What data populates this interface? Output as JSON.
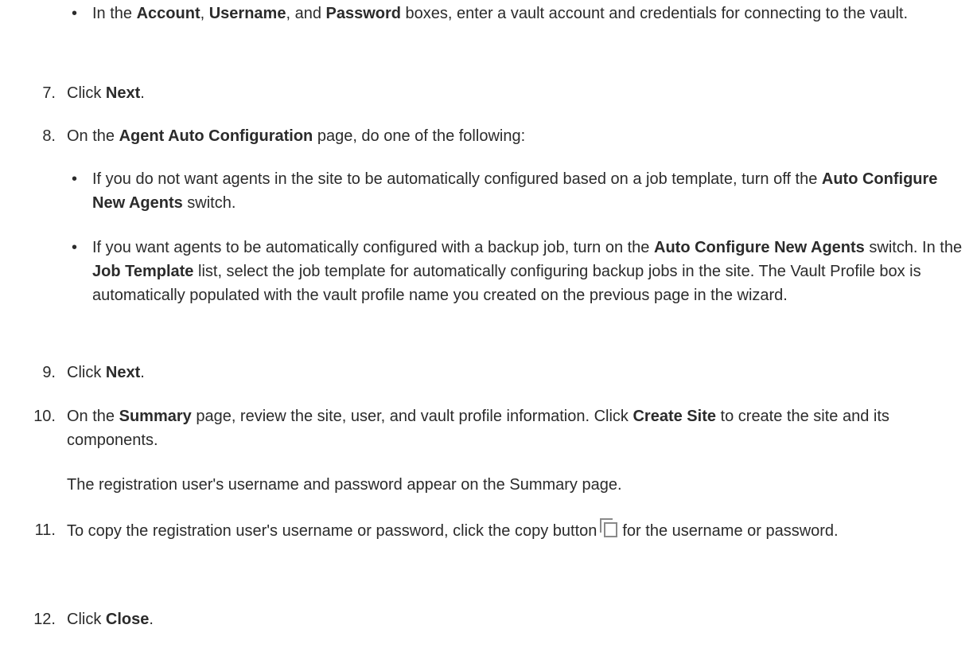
{
  "bullet_char": "•",
  "steps": {
    "s6_bullet": {
      "t1": "In the ",
      "b1": "Account",
      "t2": ", ",
      "b2": "Username",
      "t3": ", and ",
      "b3": "Password",
      "t4": " boxes, enter a vault account and credentials for connecting to the vault."
    },
    "s7": {
      "num": "7.",
      "t1": "Click ",
      "b1": "Next",
      "t2": "."
    },
    "s8": {
      "num": "8.",
      "t1": "On the ",
      "b1": "Agent Auto Configuration",
      "t2": " page, do one of the following:",
      "bullet1": {
        "t1": "If you do not want agents in the site to be automatically configured based on a job template, turn off the ",
        "b1": "Auto Configure New Agents",
        "t2": " switch."
      },
      "bullet2": {
        "t1": "If you want agents to be automatically configured with a backup job, turn on the ",
        "b1": "Auto Configure New Agents",
        "t2": " switch. In the ",
        "b2": "Job Template",
        "t3": " list, select the job template for automatically configuring backup jobs in the site. The Vault Profile box is automatically populated with the vault profile name you created on the previous page in the wizard."
      }
    },
    "s9": {
      "num": "9.",
      "t1": "Click ",
      "b1": "Next",
      "t2": "."
    },
    "s10": {
      "num": "10.",
      "t1": "On the ",
      "b1": "Summary",
      "t2": " page, review the site, user, and vault profile information. Click ",
      "b2": "Create Site",
      "t3": " to create the site and its components.",
      "note": "The registration user's username and password appear on the Summary page."
    },
    "s11": {
      "num": "11.",
      "t1": "To copy the registration user's username or password, click the copy button",
      "t2": "for the username or password.",
      "icon": "copy-icon"
    },
    "s12": {
      "num": "12.",
      "t1": "Click ",
      "b1": "Close",
      "t2": "."
    }
  }
}
